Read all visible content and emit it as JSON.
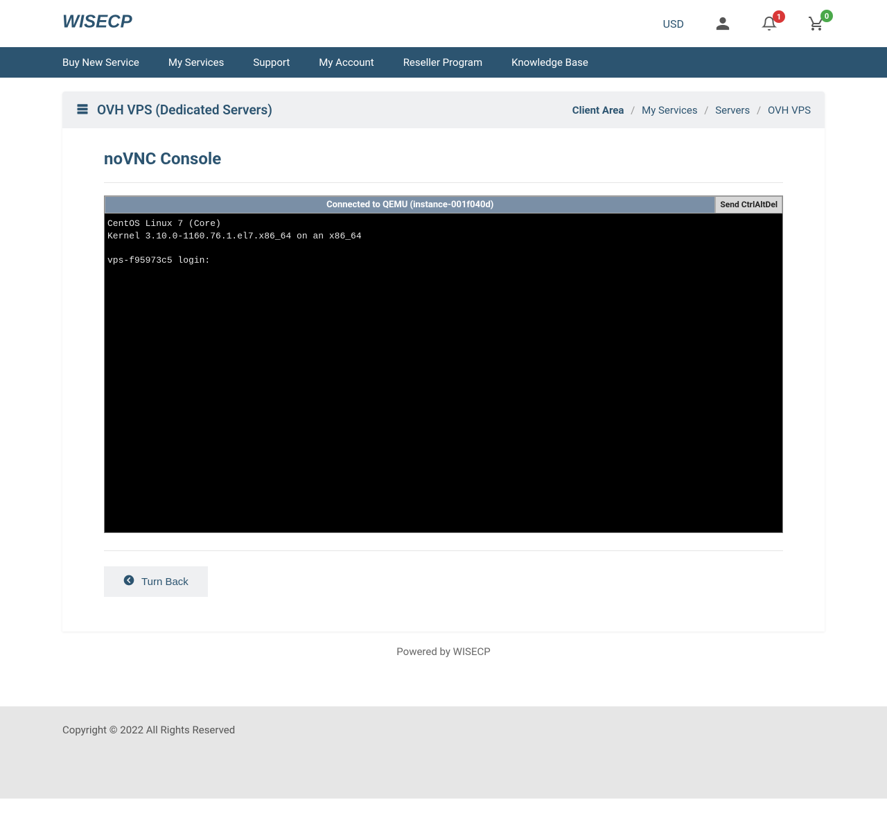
{
  "header": {
    "logo_text": "WISECP",
    "currency": "USD",
    "notifications_count": "1",
    "cart_count": "0"
  },
  "nav": {
    "items": [
      "Buy New Service",
      "My Services",
      "Support",
      "My Account",
      "Reseller Program",
      "Knowledge Base"
    ]
  },
  "page": {
    "title": "OVH VPS (Dedicated Servers)",
    "section_title": "noVNC Console"
  },
  "breadcrumb": {
    "items": [
      "Client Area",
      "My Services",
      "Servers",
      "OVH VPS"
    ]
  },
  "vnc": {
    "status": "Connected to QEMU (instance-001f040d)",
    "ctrl_alt_del": "Send CtrlAltDel",
    "terminal_lines": [
      "CentOS Linux 7 (Core)",
      "Kernel 3.10.0-1160.76.1.el7.x86_64 on an x86_64",
      "",
      "vps-f95973c5 login:"
    ]
  },
  "buttons": {
    "turn_back": "Turn Back"
  },
  "footer": {
    "powered": "Powered by WISECP",
    "copyright": "Copyright © 2022 All Rights Reserved"
  }
}
